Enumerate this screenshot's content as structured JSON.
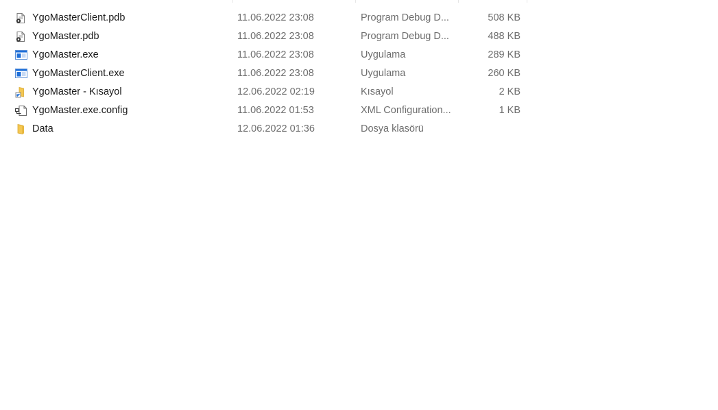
{
  "files": [
    {
      "name": "YgoMasterClient.pdb",
      "modified": "11.06.2022 23:08",
      "type": "Program Debug D...",
      "size": "508 KB",
      "icon": "pdb-file-icon"
    },
    {
      "name": "YgoMaster.pdb",
      "modified": "11.06.2022 23:08",
      "type": "Program Debug D...",
      "size": "488 KB",
      "icon": "pdb-file-icon"
    },
    {
      "name": "YgoMaster.exe",
      "modified": "11.06.2022 23:08",
      "type": "Uygulama",
      "size": "289 KB",
      "icon": "exe-application-icon"
    },
    {
      "name": "YgoMasterClient.exe",
      "modified": "11.06.2022 23:08",
      "type": "Uygulama",
      "size": "260 KB",
      "icon": "exe-application-icon"
    },
    {
      "name": "YgoMaster - Kısayol",
      "modified": "12.06.2022 02:19",
      "type": "Kısayol",
      "size": "2 KB",
      "icon": "shortcut-icon"
    },
    {
      "name": "YgoMaster.exe.config",
      "modified": "11.06.2022 01:53",
      "type": "XML Configuration...",
      "size": "1 KB",
      "icon": "config-file-icon"
    },
    {
      "name": "Data",
      "modified": "12.06.2022 01:36",
      "type": "Dosya klasörü",
      "size": "",
      "icon": "folder-icon"
    }
  ],
  "colors": {
    "folder": "#f4c752",
    "exe_accent": "#1e6fd9"
  }
}
